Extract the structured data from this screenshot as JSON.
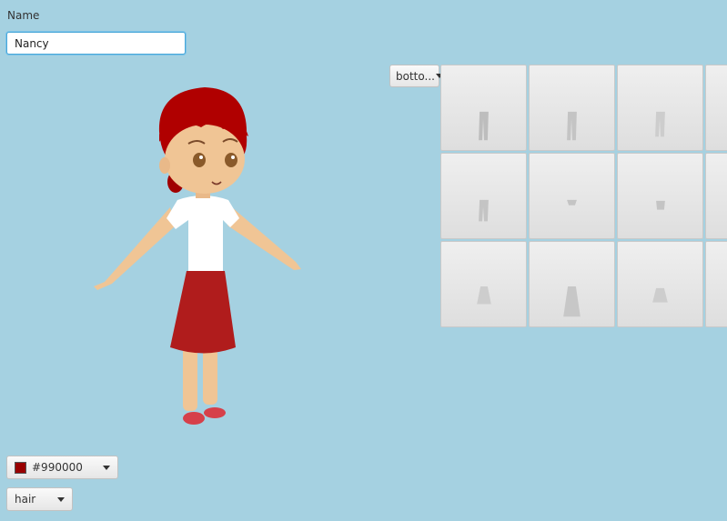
{
  "name_field": {
    "label": "Name",
    "value": "Nancy"
  },
  "category_select": {
    "value": "botto...",
    "icon": "chevron-down-icon"
  },
  "color_select": {
    "value": "#990000",
    "swatch_color": "#990000",
    "icon": "chevron-down-icon"
  },
  "part_select": {
    "value": "hair",
    "icon": "chevron-down-icon"
  },
  "character": {
    "hair_color": "#b00000",
    "skirt_color": "#b01c1c",
    "shirt_color": "#ffffff",
    "skin_color": "#f0c595",
    "shoe_color": "#d6404a"
  },
  "items": [
    {
      "kind": "long-pants"
    },
    {
      "kind": "long-pants"
    },
    {
      "kind": "long-pants"
    },
    {
      "kind": "partial"
    },
    {
      "kind": "capri-pants"
    },
    {
      "kind": "briefs"
    },
    {
      "kind": "shorts"
    },
    {
      "kind": "partial"
    },
    {
      "kind": "short-skirt"
    },
    {
      "kind": "long-skirt"
    },
    {
      "kind": "mini-skirt"
    },
    {
      "kind": "partial"
    }
  ]
}
